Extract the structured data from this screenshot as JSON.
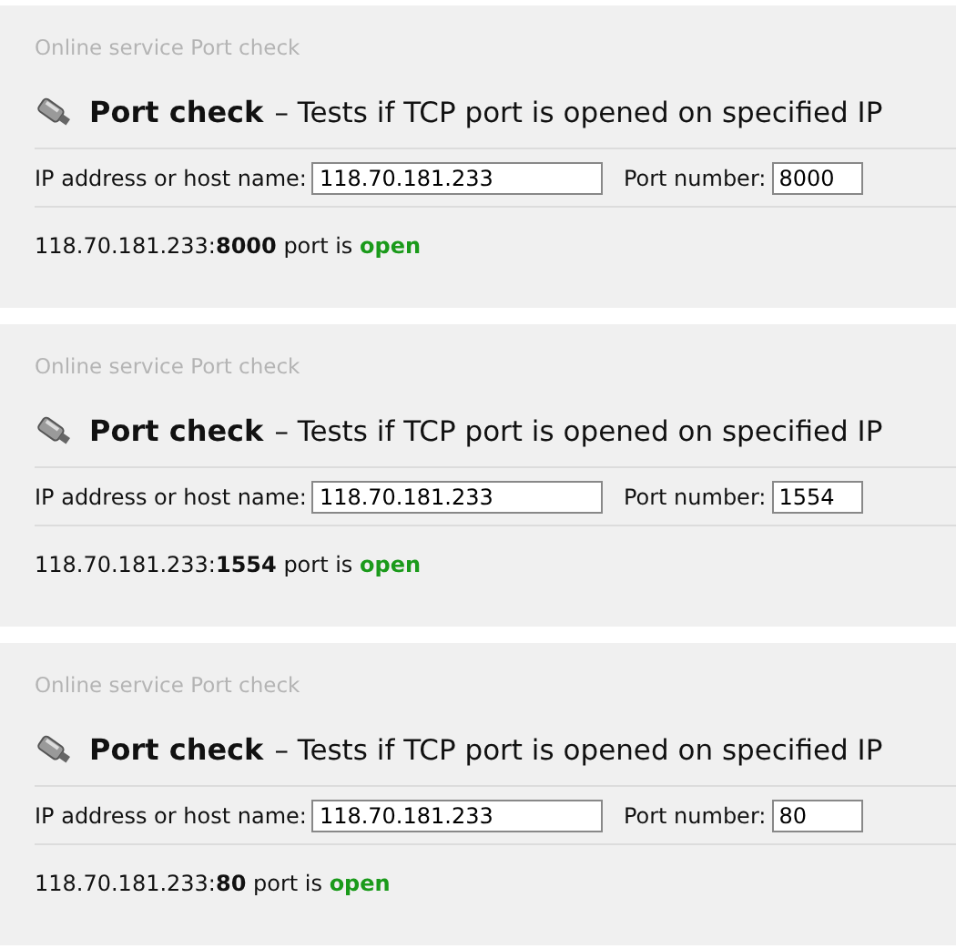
{
  "panels": [
    {
      "breadcrumb": "Online service Port check",
      "title": "Port check",
      "subtitle": "– Tests if TCP port is opened on specified IP",
      "ip_label": "IP address or host name:",
      "ip_value": "118.70.181.233",
      "port_label": "Port number:",
      "port_value": "8000",
      "result": "118.70.181.233:**8000** port is ",
      "status": "open",
      "open": true
    },
    {
      "breadcrumb": "Online service Port check",
      "title": "Port check",
      "subtitle": "– Tests if TCP port is opened on specified IP",
      "ip_label": "IP address or host name:",
      "ip_value": "118.70.181.233",
      "port_label": "Port number:",
      "port_value": "1554",
      "result": "118.70.181.233:**1554** port is ",
      "status": "open",
      "open": true
    },
    {
      "breadcrumb": "Online service Port check",
      "title": "Port check",
      "subtitle": "– Tests if TCP port is opened on specified IP",
      "ip_label": "IP address or host name:",
      "ip_value": "118.70.181.233",
      "port_label": "Port number:",
      "port_value": "80",
      "result": "118.70.181.233:**80** port is ",
      "status": "open",
      "open": true
    }
  ]
}
